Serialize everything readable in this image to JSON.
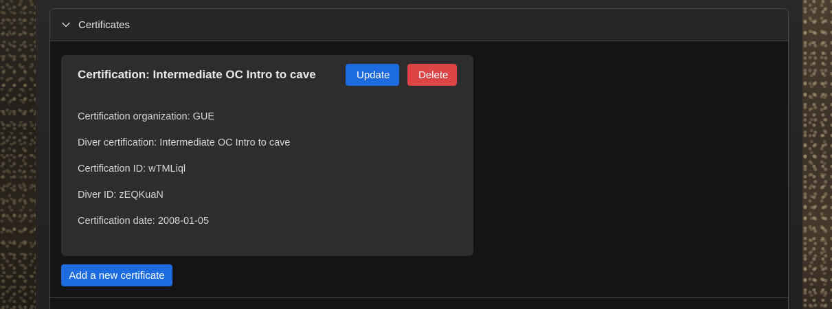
{
  "section": {
    "title": "Certificates",
    "expanded": true
  },
  "certificate": {
    "title": "Certification: Intermediate OC Intro to cave",
    "update_label": "Update",
    "delete_label": "Delete",
    "fields": {
      "organization": "Certification organization: GUE",
      "diver_certification": "Diver certification: Intermediate OC Intro to cave",
      "certification_id": "Certification ID: wTMLiql",
      "diver_id": "Diver ID: zEQKuaN",
      "certification_date": "Certification date: 2008-01-05"
    }
  },
  "add_certificate_label": "Add a new certificate",
  "colors": {
    "primary": "#1c6ce0",
    "danger": "#dc4446",
    "card_bg": "#2d2d2d",
    "panel_bg": "#141414"
  },
  "icons": {
    "section_toggle": "chevron-down-icon"
  }
}
